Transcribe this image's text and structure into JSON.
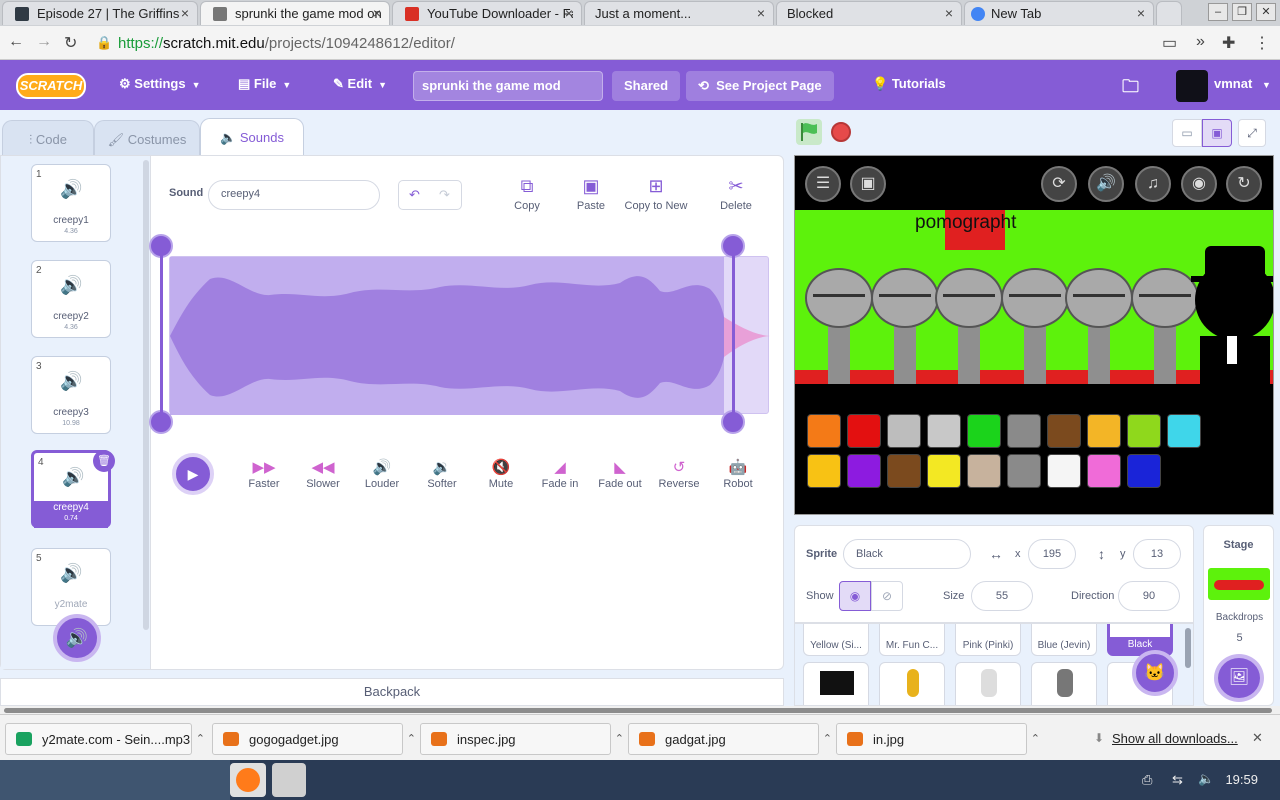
{
  "browser": {
    "tabs": [
      {
        "label": "Episode 27 | The Griffins",
        "color": "#303a44"
      },
      {
        "label": "sprunki the game mod on Scratch",
        "color": "#555555"
      },
      {
        "label": "YouTube Downloader - Fast",
        "color": "#d93025"
      },
      {
        "label": "Just a moment...",
        "color": ""
      },
      {
        "label": "Blocked",
        "color": ""
      },
      {
        "label": "New Tab",
        "color": "#4285f4"
      }
    ],
    "url_scheme": "https://",
    "url_host": "scratch.mit.edu",
    "url_path": "/projects/1094248612/editor/"
  },
  "menubar": {
    "logo": "SCRATCH",
    "settings": "Settings",
    "file": "File",
    "edit": "Edit",
    "project_title": "sprunki the game mod",
    "shared": "Shared",
    "see_project": "See Project Page",
    "tutorials": "Tutorials",
    "username": "vmnat"
  },
  "editor_tabs": {
    "code": "Code",
    "costumes": "Costumes",
    "sounds": "Sounds"
  },
  "sounds": [
    {
      "num": "1",
      "name": "creepy1",
      "dur": "4.36"
    },
    {
      "num": "2",
      "name": "creepy2",
      "dur": "4.36"
    },
    {
      "num": "3",
      "name": "creepy3",
      "dur": "10.98"
    },
    {
      "num": "4",
      "name": "creepy4",
      "dur": "0.74"
    },
    {
      "num": "5",
      "name": "y2mate",
      "dur": ""
    }
  ],
  "sound_editor": {
    "sound_label": "Sound",
    "sound_name": "creepy4",
    "tools": {
      "copy": "Copy",
      "paste": "Paste",
      "copy_new": "Copy to New",
      "delete": "Delete"
    },
    "effects": {
      "faster": "Faster",
      "slower": "Slower",
      "louder": "Louder",
      "softer": "Softer",
      "mute": "Mute",
      "fade_in": "Fade in",
      "fade_out": "Fade out",
      "reverse": "Reverse",
      "robot": "Robot"
    }
  },
  "backpack": "Backpack",
  "stage": {
    "title_text": "pomographt",
    "accent": "#855cd6"
  },
  "sprite_info": {
    "sprite_label": "Sprite",
    "sprite_name": "Black",
    "x_label": "x",
    "x": "195",
    "y_label": "y",
    "y": "13",
    "show_label": "Show",
    "size_label": "Size",
    "size": "55",
    "direction_label": "Direction",
    "direction": "90"
  },
  "sprites": [
    "Yellow (Si...",
    "Mr. Fun C...",
    "Pink (Pinki)",
    "Blue (Jevin)",
    "Black"
  ],
  "stage_pane": {
    "title": "Stage",
    "backdrops": "Backdrops",
    "count": "5"
  },
  "downloads": [
    {
      "name": "y2mate.com - Sein....mp3",
      "color": "#1aa260"
    },
    {
      "name": "gogogadget.jpg",
      "color": "#e8711a"
    },
    {
      "name": "inspec.jpg",
      "color": "#e8711a"
    },
    {
      "name": "gadgat.jpg",
      "color": "#e8711a"
    },
    {
      "name": "in.jpg",
      "color": "#e8711a"
    }
  ],
  "show_all": "Show all downloads...",
  "clock": "19:59"
}
